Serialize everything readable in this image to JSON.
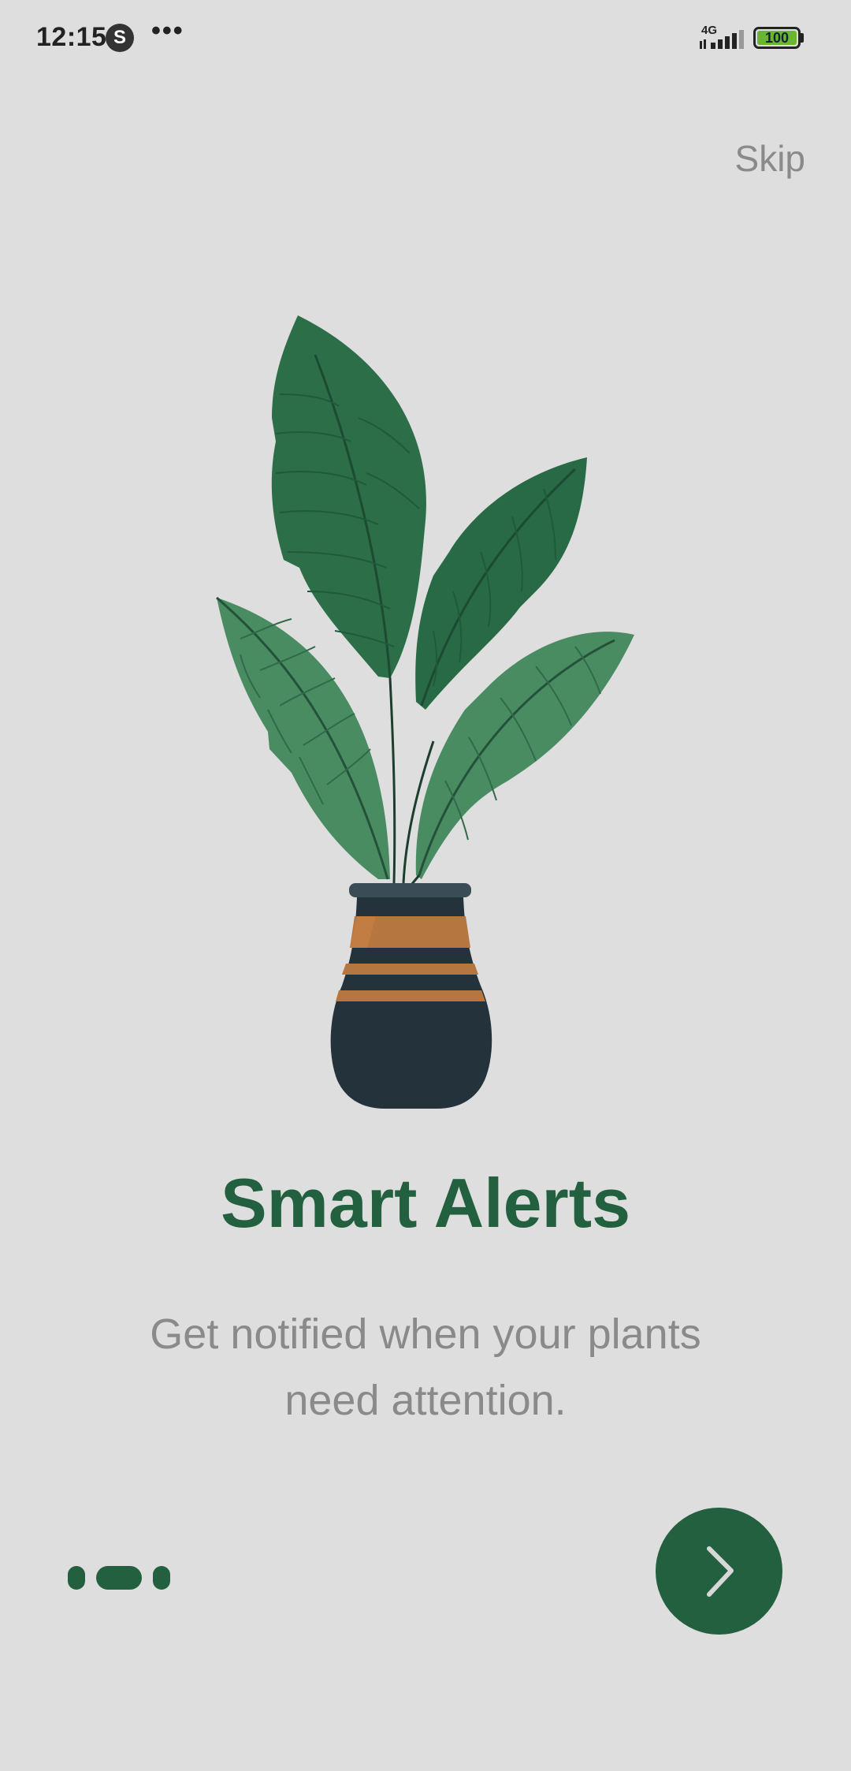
{
  "status_bar": {
    "time": "12:15",
    "app_badge": "S",
    "more": "•••",
    "network": "4G",
    "battery": "100"
  },
  "onboarding": {
    "skip_label": "Skip",
    "title": "Smart Alerts",
    "description": "Get notified when your plants need attention.",
    "page_count": 3,
    "active_page": 2,
    "next_icon": "chevron-right-icon"
  },
  "colors": {
    "background": "#dedede",
    "accent": "#226040",
    "muted_text": "#8a8a8a",
    "pot_dark": "#24323b",
    "pot_stripe": "#b5763f"
  }
}
